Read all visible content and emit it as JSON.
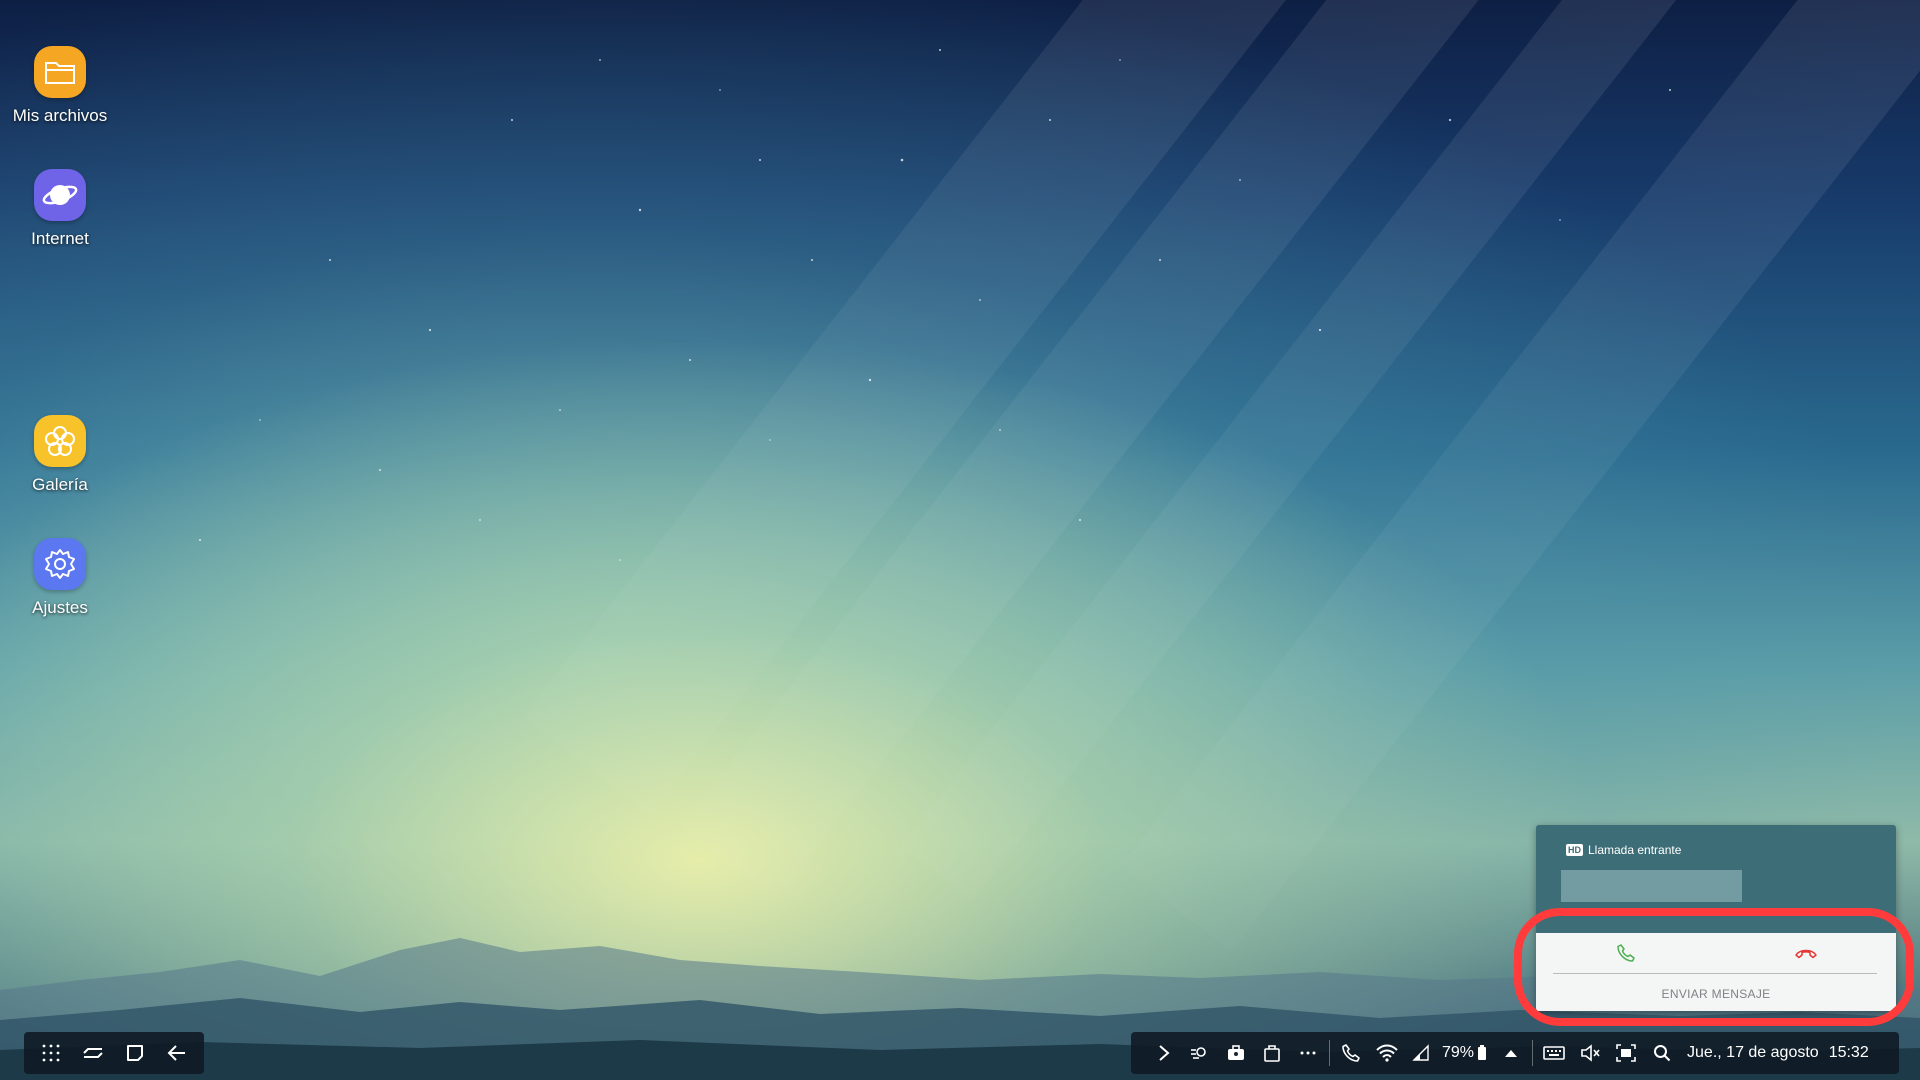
{
  "desktop": {
    "icons": [
      {
        "label": "Mis archivos",
        "icon": "folder-icon",
        "color": "#f5a623"
      },
      {
        "label": "Internet",
        "icon": "internet-planet-icon",
        "color": "#6f63e8"
      },
      {
        "label": "Galería",
        "icon": "gallery-flower-icon",
        "color": "#f8c22b"
      },
      {
        "label": "Ajustes",
        "icon": "gear-icon",
        "color": "#5b78f0"
      }
    ]
  },
  "taskbar": {
    "left_buttons": [
      "apps-grid-icon",
      "recent-apps-icon",
      "home-icon",
      "back-icon"
    ],
    "tray_icons": [
      "chevron-right-icon",
      "location-icon",
      "work-briefcase-icon",
      "shopping-bag-icon",
      "more-dots-icon",
      "call-icon",
      "wifi-icon",
      "signal-icon"
    ],
    "battery_percent": "79%",
    "date": "Jue., 17 de agosto",
    "time": "15:32"
  },
  "call_popup": {
    "hd_label": "HD",
    "title": "Llamada entrante",
    "send_message": "ENVIAR MENSAJE",
    "accept_color": "#4caf50",
    "decline_color": "#e53935"
  },
  "highlight_color": "#ff3b3b"
}
